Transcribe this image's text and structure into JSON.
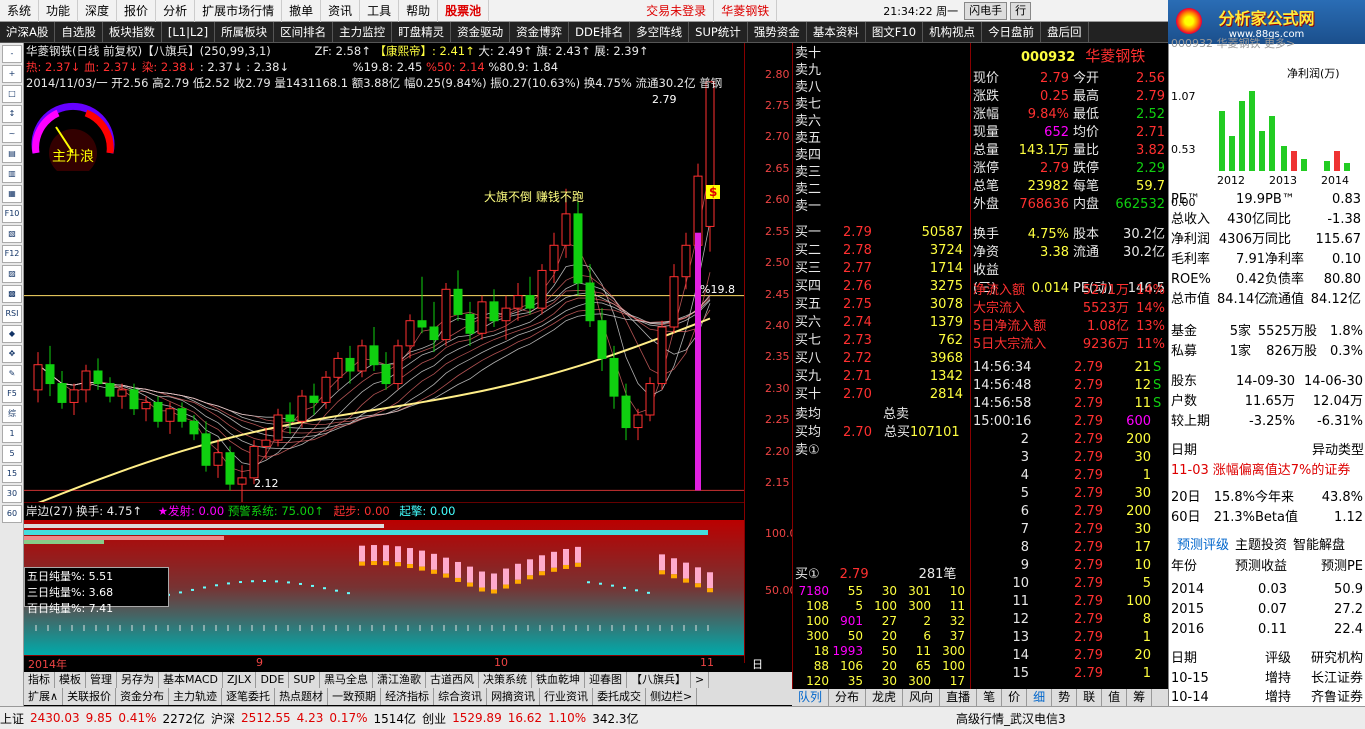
{
  "menu": [
    "系统",
    "功能",
    "深度",
    "报价",
    "分析",
    "扩展市场行情",
    "撤单",
    "资讯",
    "工具",
    "帮助"
  ],
  "menu_highlight": "股票池",
  "login_status": "交易未登录",
  "stock_header": "华菱钢铁",
  "clock": "21:34:22 周一",
  "btn_flash": "闪电手",
  "btn_row": "行",
  "logo_title": "分析家公式网",
  "logo_url": "www.88gs.com",
  "tabs": [
    "沪深A股",
    "自选股",
    "板块指数",
    "[L1|L2]",
    "所属板块",
    "区间排名",
    "主力监控",
    "盯盘精灵",
    "资金驱动",
    "资金博弈",
    "DDE排名",
    "多空阵线",
    "SUP统计",
    "强势资金",
    "基本资料",
    "图文F10",
    "机构视点",
    "今日盘前",
    "盘后回"
  ],
  "left_tools": [
    "-",
    "+",
    "□",
    "↕",
    "~",
    "▤",
    "▥",
    "▦",
    "F10",
    "▧",
    "F12",
    "▨",
    "▩",
    "RSI",
    "◆",
    "✥",
    "✎",
    "F5",
    "综",
    "1",
    "5",
    "15",
    "30",
    "60"
  ],
  "chart_info": {
    "line1": "华菱钢铁(日线 前复权)【八旗兵】(250,99,3,1)",
    "zf": "ZF: 2.58↑",
    "kangzi": "【康熙帝】: 2.41↑",
    "da": "大: 2.49↑",
    "qi": "旗: 2.43↑",
    "zhan": "展: 2.39↑",
    "line2a": "热: 2.37↓",
    "line2b": "血: 2.37↓",
    "line2c": "染: 2.38↓",
    "line2d": ": 2.37↓",
    ": 2.38↓": "",
    "line2e": ": 2.38↓",
    "pct1": "%19.8: 2.45",
    "pct2": "%50: 2.14",
    "pct3": "%80.9: 1.84",
    "line3": "2014/11/03/一 开2.56 高2.79 低2.52 收2.79 量1431168.1 额3.88亿 幅0.25(9.84%) 振0.27(10.63%) 换4.75% 流通30.2亿 普钢"
  },
  "chart_annot": {
    "text": "大旗不倒 赚钱不跑",
    "high_label": "2.79",
    "low_label": "2.12",
    "pct_label": "%19.8",
    "dollar": "$"
  },
  "gauge_label": "主升浪",
  "y_ticks": [
    "2.80",
    "2.75",
    "2.70",
    "2.65",
    "2.60",
    "2.55",
    "2.50",
    "2.45",
    "2.40",
    "2.35",
    "2.30",
    "2.25",
    "2.20",
    "2.15"
  ],
  "sub_header": {
    "a": "岸边(27)",
    "b": "换手: 4.75↑",
    "c": "★发射: 0.00",
    "d": "预警系统: 75.00↑",
    "e": "起步: 0.00",
    "f": "起擎: 0.00"
  },
  "sub_y": [
    "100.0",
    "50.00"
  ],
  "sub_legend": [
    "五日纯量%: 5.51",
    "三日纯量%: 3.68",
    "百日纯量%: 7.41"
  ],
  "x_labels": [
    "2014年",
    "9",
    "10",
    "11"
  ],
  "period": "日线",
  "lowtabs": [
    "指标",
    "模板",
    "管理",
    "另存为",
    "基本MACD",
    "ZJLX",
    "DDE",
    "SUP",
    "黑马全息",
    "潇江渔歌",
    "古道西风",
    "决策系统",
    "铁血乾坤",
    "迎春图",
    "【八旗兵】",
    ">"
  ],
  "lowtabs2": [
    "扩展∧",
    "关联报价",
    "资金分布",
    "主力轨迹",
    "逐笔委托",
    "热点题材",
    "一致预期",
    "经济指标",
    "综合资讯",
    "网摘资讯",
    "行业资讯",
    "委托成交"
  ],
  "side_btn": "侧边栏>",
  "sell_labels": [
    "卖十",
    "卖九",
    "卖八",
    "卖七",
    "卖六",
    "卖五",
    "卖四",
    "卖三",
    "卖二",
    "卖一"
  ],
  "buy": [
    [
      "买一",
      "2.79",
      "50587"
    ],
    [
      "买二",
      "2.78",
      "3724"
    ],
    [
      "买三",
      "2.77",
      "1714"
    ],
    [
      "买四",
      "2.76",
      "3275"
    ],
    [
      "买五",
      "2.75",
      "3078"
    ],
    [
      "买六",
      "2.74",
      "1379"
    ],
    [
      "买七",
      "2.73",
      "762"
    ],
    [
      "买八",
      "2.72",
      "3968"
    ],
    [
      "买九",
      "2.71",
      "1342"
    ],
    [
      "买十",
      "2.70",
      "2814"
    ]
  ],
  "avg": {
    "sell_avg": "卖均",
    "total_sell": "总卖",
    "buy_avg": "买均",
    "buy_avg_val": "2.70",
    "total_buy": "总买",
    "total_buy_val": "107101",
    "sell1": "卖①"
  },
  "buy1": {
    "label": "买①",
    "price": "2.79",
    "count": "281笔"
  },
  "queue": [
    [
      "7180",
      "55",
      "30",
      "301",
      "10"
    ],
    [
      "108",
      "5",
      "100",
      "300",
      "11"
    ],
    [
      "100",
      "901",
      "27",
      "2",
      "32"
    ],
    [
      "300",
      "50",
      "20",
      "6",
      "37"
    ],
    [
      "18",
      "1993",
      "50",
      "11",
      "300"
    ],
    [
      "88",
      "106",
      "20",
      "65",
      "100"
    ],
    [
      "120",
      "35",
      "30",
      "300",
      "17"
    ]
  ],
  "ob_tabs": [
    "队列",
    "分布",
    "龙虎",
    "风向",
    "直播"
  ],
  "code": "000932",
  "name": "华菱钢铁",
  "quote": [
    [
      "现价",
      "2.79",
      "今开",
      "2.56"
    ],
    [
      "涨跌",
      "0.25",
      "最高",
      "2.79"
    ],
    [
      "涨幅",
      "9.84%",
      "最低",
      "2.52"
    ],
    [
      "现量",
      "652",
      "均价",
      "2.71"
    ],
    [
      "总量",
      "143.1万",
      "量比",
      "3.82"
    ],
    [
      "涨停",
      "2.79",
      "跌停",
      "2.29"
    ],
    [
      "总笔",
      "23982",
      "每笔",
      "59.7"
    ],
    [
      "外盘",
      "768636",
      "内盘",
      "662532"
    ]
  ],
  "quote2": [
    [
      "换手",
      "4.75%",
      "股本",
      "30.2亿"
    ],
    [
      "净资",
      "3.38",
      "流通",
      "30.2亿"
    ],
    [
      "收益(三)",
      "0.014",
      "PE(动)",
      "146.5"
    ]
  ],
  "flow": [
    [
      "净流入额",
      "5271万",
      "14%"
    ],
    [
      "大宗流入",
      "5523万",
      "14%"
    ],
    [
      "5日净流入额",
      "1.08亿",
      "13%"
    ],
    [
      "5日大宗流入",
      "9236万",
      "11%"
    ]
  ],
  "ticks": [
    [
      "14:56:34",
      "2.79",
      "21",
      "S"
    ],
    [
      "14:56:48",
      "2.79",
      "12",
      "S"
    ],
    [
      "14:56:58",
      "2.79",
      "11",
      "S"
    ],
    [
      "15:00:16",
      "2.79",
      "600",
      ""
    ],
    [
      "2",
      "2.79",
      "200",
      ""
    ],
    [
      "3",
      "2.79",
      "30",
      ""
    ],
    [
      "4",
      "2.79",
      "1",
      ""
    ],
    [
      "5",
      "2.79",
      "30",
      ""
    ],
    [
      "6",
      "2.79",
      "200",
      ""
    ],
    [
      "7",
      "2.79",
      "30",
      ""
    ],
    [
      "8",
      "2.79",
      "17",
      ""
    ],
    [
      "9",
      "2.79",
      "10",
      ""
    ],
    [
      "10",
      "2.79",
      "5",
      ""
    ],
    [
      "11",
      "2.79",
      "100",
      ""
    ],
    [
      "12",
      "2.79",
      "8",
      ""
    ],
    [
      "13",
      "2.79",
      "1",
      ""
    ],
    [
      "14",
      "2.79",
      "20",
      ""
    ],
    [
      "15",
      "2.79",
      "1",
      ""
    ]
  ],
  "q_tabs": [
    "笔",
    "价",
    "细",
    "势",
    "联",
    "值",
    "筹"
  ],
  "fund_top": {
    "tab1": "净利润(万)",
    "vals": [
      "1.07",
      "0.53",
      "0.00"
    ],
    "years": [
      "2012",
      "2013",
      "2014"
    ],
    "cut": "000932    华菱钢铁    更多>"
  },
  "fund_rows": [
    [
      "PE™",
      "19.9",
      "PB™",
      "0.83"
    ],
    [
      "总收入",
      "430亿",
      "同比",
      "-1.38"
    ],
    [
      "净利润",
      "4306万",
      "同比",
      "115.67"
    ],
    [
      "毛利率",
      "7.91",
      "净利率",
      "0.10"
    ],
    [
      "ROE%",
      "0.42",
      "负债率",
      "80.80"
    ],
    [
      "总市值",
      "84.14亿",
      "流通值",
      "84.12亿"
    ]
  ],
  "fund_inst": [
    [
      "基金",
      "5家",
      "5525万股",
      "1.8%"
    ],
    [
      "私募",
      "1家",
      "826万股",
      "0.3%"
    ]
  ],
  "holders": [
    [
      "股东",
      "14-09-30",
      "14-06-30"
    ],
    [
      "户数",
      "11.65万",
      "12.04万"
    ],
    [
      "较上期",
      "-3.25%",
      "-6.31%"
    ]
  ],
  "events": {
    "h1": "日期",
    "h2": "异动类型",
    "d": "11-03",
    "t": "涨幅偏离值达7%的证券"
  },
  "stats": [
    [
      "20日",
      "15.8%",
      "今年来",
      "43.8%"
    ],
    [
      "60日",
      "21.3%",
      "Beta值",
      "1.12"
    ]
  ],
  "fc_tabs": [
    "预测评级",
    "主题投资",
    "智能解盘"
  ],
  "forecast_hdr": [
    "年份",
    "预测收益",
    "预测PE"
  ],
  "forecast": [
    [
      "2014",
      "0.03",
      "50.9"
    ],
    [
      "2015",
      "0.07",
      "27.2"
    ],
    [
      "2016",
      "0.11",
      "22.4"
    ]
  ],
  "rating_hdr": [
    "日期",
    "评级",
    "研究机构"
  ],
  "ratings": [
    [
      "10-15",
      "增持",
      "长江证券"
    ],
    [
      "10-14",
      "增持",
      "齐鲁证券"
    ]
  ],
  "status": {
    "sh": "上证",
    "sh_v": "2430.03",
    "sh_c": "9.85",
    "sh_p": "0.41%",
    "sh_a": "2272亿",
    "sz": "沪深",
    "sz_v": "2512.55",
    "sz_c": "4.23",
    "sz_p": "0.17%",
    "sz_a": "1514亿",
    "cy": "创业",
    "cy_v": "1529.89",
    "cy_c": "16.62",
    "cy_p": "1.10%",
    "cy_a": "342.3亿",
    "srv": "高级行情_武汉电信3"
  },
  "colors": {
    "up": "#ff3030",
    "down": "#10d010",
    "accent": "#ffff40"
  },
  "chart_data": {
    "type": "candlestick",
    "ylim": [
      2.12,
      2.82
    ],
    "candles": [
      [
        2.3,
        2.36,
        2.28,
        2.34
      ],
      [
        2.34,
        2.37,
        2.29,
        2.31
      ],
      [
        2.31,
        2.33,
        2.27,
        2.28
      ],
      [
        2.28,
        2.31,
        2.26,
        2.3
      ],
      [
        2.3,
        2.34,
        2.28,
        2.33
      ],
      [
        2.33,
        2.35,
        2.3,
        2.31
      ],
      [
        2.31,
        2.32,
        2.28,
        2.29
      ],
      [
        2.29,
        2.31,
        2.27,
        2.3
      ],
      [
        2.3,
        2.31,
        2.26,
        2.27
      ],
      [
        2.27,
        2.29,
        2.25,
        2.28
      ],
      [
        2.28,
        2.29,
        2.24,
        2.25
      ],
      [
        2.25,
        2.28,
        2.23,
        2.27
      ],
      [
        2.27,
        2.28,
        2.24,
        2.25
      ],
      [
        2.25,
        2.26,
        2.22,
        2.23
      ],
      [
        2.23,
        2.25,
        2.17,
        2.18
      ],
      [
        2.18,
        2.22,
        2.16,
        2.2
      ],
      [
        2.2,
        2.21,
        2.14,
        2.15
      ],
      [
        2.15,
        2.18,
        2.12,
        2.16
      ],
      [
        2.16,
        2.22,
        2.15,
        2.21
      ],
      [
        2.21,
        2.24,
        2.19,
        2.22
      ],
      [
        2.22,
        2.27,
        2.21,
        2.26
      ],
      [
        2.26,
        2.28,
        2.23,
        2.25
      ],
      [
        2.25,
        2.3,
        2.24,
        2.29
      ],
      [
        2.29,
        2.31,
        2.26,
        2.28
      ],
      [
        2.28,
        2.33,
        2.27,
        2.32
      ],
      [
        2.32,
        2.36,
        2.3,
        2.35
      ],
      [
        2.35,
        2.37,
        2.31,
        2.33
      ],
      [
        2.33,
        2.38,
        2.32,
        2.37
      ],
      [
        2.37,
        2.4,
        2.33,
        2.34
      ],
      [
        2.34,
        2.36,
        2.3,
        2.31
      ],
      [
        2.31,
        2.38,
        2.3,
        2.37
      ],
      [
        2.37,
        2.42,
        2.35,
        2.41
      ],
      [
        2.41,
        2.48,
        2.39,
        2.4
      ],
      [
        2.4,
        2.44,
        2.36,
        2.38
      ],
      [
        2.38,
        2.47,
        2.37,
        2.46
      ],
      [
        2.46,
        2.49,
        2.41,
        2.42
      ],
      [
        2.42,
        2.44,
        2.37,
        2.39
      ],
      [
        2.39,
        2.45,
        2.38,
        2.44
      ],
      [
        2.44,
        2.46,
        2.4,
        2.41
      ],
      [
        2.41,
        2.45,
        2.38,
        2.43
      ],
      [
        2.43,
        2.47,
        2.41,
        2.45
      ],
      [
        2.45,
        2.48,
        2.42,
        2.43
      ],
      [
        2.43,
        2.5,
        2.42,
        2.49
      ],
      [
        2.49,
        2.55,
        2.47,
        2.53
      ],
      [
        2.53,
        2.62,
        2.51,
        2.58
      ],
      [
        2.58,
        2.6,
        2.45,
        2.47
      ],
      [
        2.47,
        2.5,
        2.4,
        2.41
      ],
      [
        2.41,
        2.43,
        2.33,
        2.35
      ],
      [
        2.35,
        2.37,
        2.27,
        2.29
      ],
      [
        2.29,
        2.31,
        2.22,
        2.24
      ],
      [
        2.24,
        2.27,
        2.22,
        2.26
      ],
      [
        2.26,
        2.32,
        2.25,
        2.31
      ],
      [
        2.31,
        2.41,
        2.3,
        2.4
      ],
      [
        2.4,
        2.5,
        2.39,
        2.48
      ],
      [
        2.48,
        2.55,
        2.46,
        2.53
      ],
      [
        2.53,
        2.66,
        2.5,
        2.64
      ],
      [
        2.56,
        2.79,
        2.52,
        2.79
      ]
    ]
  }
}
